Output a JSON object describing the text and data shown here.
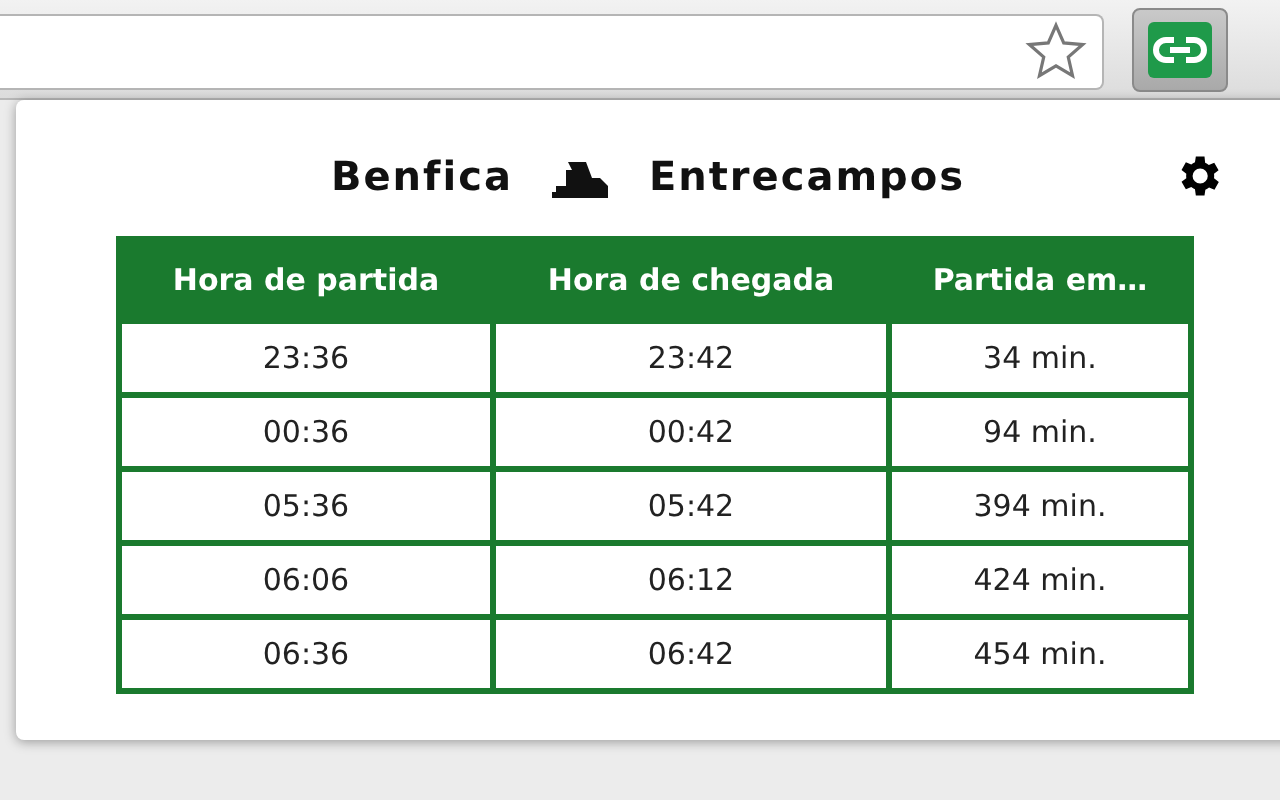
{
  "route": {
    "origin": "Benfica",
    "destination": "Entrecampos"
  },
  "table": {
    "columns": [
      "Hora de partida",
      "Hora de chegada",
      "Partida em…"
    ],
    "rows": [
      [
        "23:36",
        "23:42",
        "34 min."
      ],
      [
        "00:36",
        "00:42",
        "94 min."
      ],
      [
        "05:36",
        "05:42",
        "394 min."
      ],
      [
        "06:06",
        "06:12",
        "424 min."
      ],
      [
        "06:36",
        "06:42",
        "454 min."
      ]
    ]
  }
}
